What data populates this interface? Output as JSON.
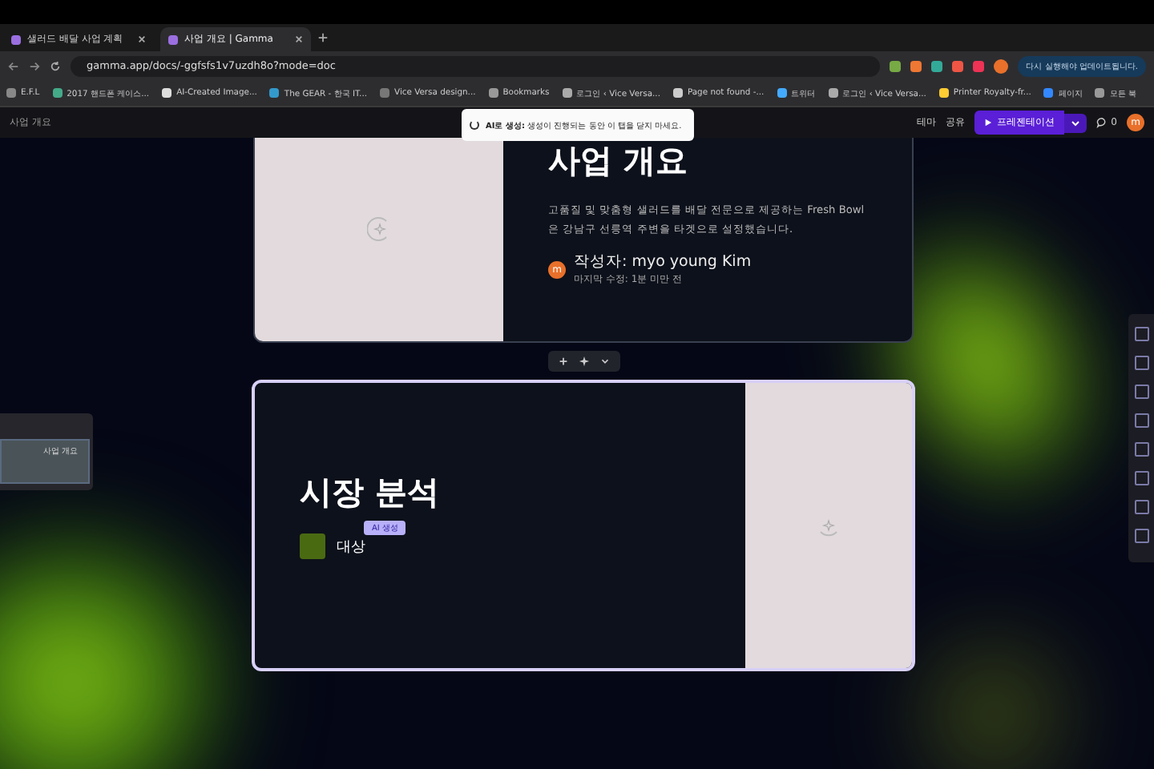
{
  "browser_tabs": [
    {
      "label": "샐러드 배달 사업 계획",
      "selected": false
    },
    {
      "label": "사업 개요 | Gamma",
      "selected": true
    }
  ],
  "address_bar": {
    "url": "gamma.app/docs/-ggfsfs1v7uzdh8o?mode=doc"
  },
  "update_button": "다시 실행해야 업데이트됩니다.",
  "bookmarks": [
    {
      "label": "E.F.L"
    },
    {
      "label": "2017 핸드폰 케이스..."
    },
    {
      "label": "AI-Created Image..."
    },
    {
      "label": "The GEAR - 한국 IT..."
    },
    {
      "label": "Vice Versa design..."
    },
    {
      "label": "Bookmarks"
    },
    {
      "label": "로그인 ‹ Vice Versa..."
    },
    {
      "label": "Page not found -..."
    },
    {
      "label": "트위터"
    },
    {
      "label": "로그인 ‹ Vice Versa..."
    },
    {
      "label": "Printer Royalty-fr..."
    },
    {
      "label": "페이지"
    },
    {
      "label": "모든 북"
    }
  ],
  "app_toolbar": {
    "breadcrumb": "사업 개요",
    "theme": "테마",
    "share": "공유",
    "present": "프레젠테이션",
    "comments": "0",
    "avatar": "m"
  },
  "toast": {
    "title": "AI로 생성:",
    "message": "생성이 진행되는 동안 이 탭을 닫지 마세요."
  },
  "cards": [
    {
      "kind": "image-left",
      "title": "사업 개요",
      "body": "고품질 및 맞춤형 샐러드를 배달 전문으로 제공하는 Fresh Bowl은 강남구 선릉역 주변을 타겟으로 설정했습니다.",
      "author": "작성자: myo young Kim",
      "edited": "마지막 수정: 1분 미만 전",
      "avatar": "m",
      "selected": false
    },
    {
      "kind": "image-right",
      "title": "시장 분석",
      "item": "대상",
      "ai_badge": "AI 생성",
      "selected": true
    }
  ],
  "thumbnail_panel": {
    "slide_title": "사업 개요"
  }
}
